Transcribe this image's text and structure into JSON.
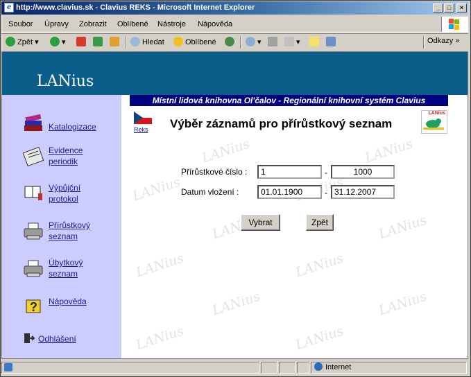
{
  "window": {
    "title": "http://www.clavius.sk - Clavius REKS - Microsoft Internet Explorer",
    "controls": {
      "minimize": "_",
      "maximize": "□",
      "close": "×"
    }
  },
  "menu": {
    "items": [
      "Soubor",
      "Úpravy",
      "Zobrazit",
      "Oblíbené",
      "Nástroje",
      "Nápověda"
    ]
  },
  "toolbar": {
    "back": "Zpět",
    "search": "Hledat",
    "favorites": "Oblíbené",
    "links": "Odkazy"
  },
  "app": {
    "logo": "LANius",
    "library": "Místní lidová knihovna Ol'čalov - Regionální knihovní systém Clavius",
    "reks": "Reks",
    "badge": "LANius",
    "watermark": "LANius"
  },
  "nav": {
    "items": [
      {
        "label": "Katalogizace",
        "icon": "books-icon"
      },
      {
        "label1": "Evidence",
        "label2": "periodik",
        "icon": "newspaper-icon"
      },
      {
        "label1": "Výpůjční",
        "label2": "protokol",
        "icon": "book-reader-icon"
      },
      {
        "label1": "Přírůstkový",
        "label2": "seznam",
        "icon": "printer-icon"
      },
      {
        "label1": "Úbytkový",
        "label2": "seznam",
        "icon": "printer-icon"
      },
      {
        "label": "Nápověda",
        "icon": "help-icon"
      }
    ],
    "logout": "Odhlášení"
  },
  "form": {
    "title": "Výběr záznamů pro přírůstkový seznam",
    "accession_label": "Přírůstkové číslo :",
    "accession_from": "1",
    "accession_to": "1000",
    "date_label": "Datum vložení :",
    "date_from": "01.01.1900",
    "date_to": "31.12.2007",
    "dash": "-",
    "select_button": "Vybrat",
    "back_button": "Zpět"
  },
  "status": {
    "zone": "Internet"
  }
}
